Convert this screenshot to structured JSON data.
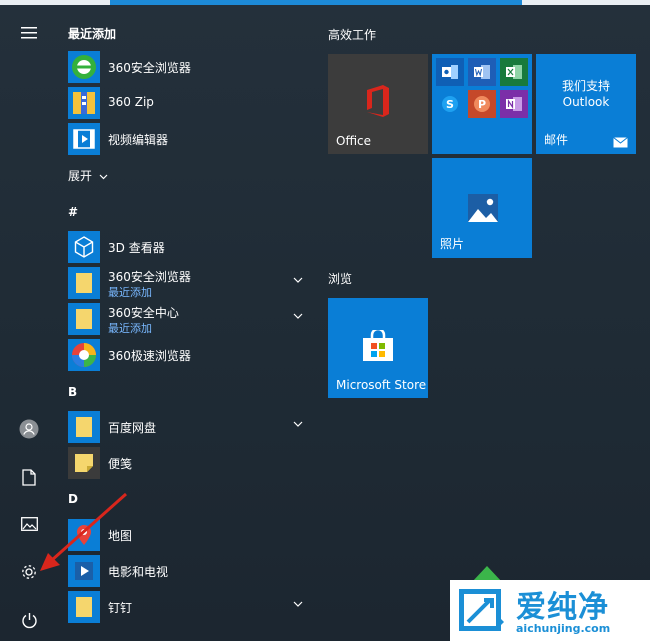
{
  "app_list": {
    "recent_title": "最近添加",
    "recent": [
      {
        "name": "360安全浏览器",
        "icon": "360-browser-icon"
      },
      {
        "name": "360 Zip",
        "icon": "zip-icon"
      },
      {
        "name": "视频编辑器",
        "icon": "video-editor-icon"
      }
    ],
    "expand_label": "展开",
    "sections": {
      "hash": "#",
      "b": "B",
      "d": "D"
    },
    "apps": {
      "viewer3d": {
        "name": "3D 查看器"
      },
      "folder360browser": {
        "name": "360安全浏览器",
        "sub": "最近添加"
      },
      "folder360center": {
        "name": "360安全中心",
        "sub": "最近添加"
      },
      "speedbrowser": {
        "name": "360极速浏览器"
      },
      "baidu": {
        "name": "百度网盘"
      },
      "stickynotes": {
        "name": "便笺"
      },
      "maps": {
        "name": "地图"
      },
      "movies": {
        "name": "电影和电视"
      },
      "dingtalk": {
        "name": "钉钉"
      }
    }
  },
  "tiles": {
    "group1_title": "高效工作",
    "office_label": "Office",
    "outlook_promo_line1": "我们支持",
    "outlook_promo_line2": "Outlook",
    "mail_label": "邮件",
    "photos_label": "照片",
    "group2_title": "浏览",
    "store_label": "Microsoft Store"
  },
  "watermark": {
    "title": "爱纯净",
    "url": "aichunjing.com"
  },
  "colors": {
    "tile_blue": "#0a7ed6",
    "office_tile": "#3c3c3c",
    "accent_red": "#d9261c"
  }
}
